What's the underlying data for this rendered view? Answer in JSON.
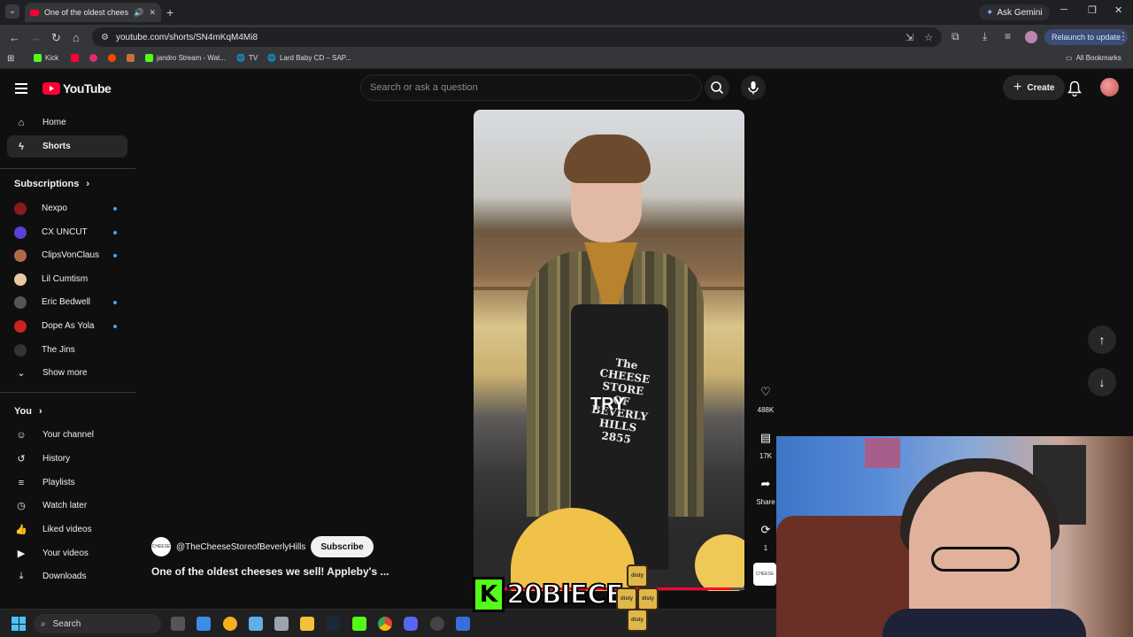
{
  "browser": {
    "tab_title": "One of the oldest cheeses w",
    "url": "youtube.com/shorts/SN4mKqM4Mi8",
    "ask_gemini": "Ask Gemini",
    "relaunch": "Relaunch to update",
    "all_bookmarks": "All Bookmarks",
    "bookmarks": [
      {
        "label": "Kick",
        "color": "#53fc18"
      },
      {
        "label": "",
        "color": "#ff0033"
      },
      {
        "label": "",
        "color": "#e22c6a"
      },
      {
        "label": "",
        "color": "#ff4500"
      },
      {
        "label": "",
        "color": "#c86f3b"
      },
      {
        "label": "jandro Stream - Wat...",
        "color": "#53fc18"
      },
      {
        "label": "TV",
        "color": "#999999"
      },
      {
        "label": "Lard Baby CD – SAP...",
        "color": "#999999"
      }
    ]
  },
  "header": {
    "logo": "YouTube",
    "search_placeholder": "Search or ask a question",
    "create": "Create"
  },
  "sidebar": {
    "main": [
      {
        "label": "Home",
        "icon": "home-icon"
      },
      {
        "label": "Shorts",
        "icon": "shorts-icon"
      }
    ],
    "subscriptions_title": "Subscriptions",
    "subscriptions": [
      {
        "label": "Nexpo",
        "color": "#8b1a1a",
        "live": true
      },
      {
        "label": "CX UNCUT",
        "color": "#5b3fd8",
        "live": true
      },
      {
        "label": "ClipsVonClaus",
        "color": "#b06a4a",
        "live": true
      },
      {
        "label": "Lil Cumtism",
        "color": "#e8c9a0",
        "live": false
      },
      {
        "label": "Eric Bedwell",
        "color": "#555555",
        "live": true
      },
      {
        "label": "Dope As Yola",
        "color": "#c22",
        "live": true
      },
      {
        "label": "The Jins",
        "color": "#333333",
        "live": false
      }
    ],
    "show_more": "Show more",
    "you_title": "You",
    "you_items": [
      {
        "label": "Your channel",
        "icon": "channel-icon"
      },
      {
        "label": "History",
        "icon": "history-icon"
      },
      {
        "label": "Playlists",
        "icon": "playlists-icon"
      },
      {
        "label": "Watch later",
        "icon": "watch-later-icon"
      },
      {
        "label": "Liked videos",
        "icon": "like-icon"
      },
      {
        "label": "Your videos",
        "icon": "your-videos-icon"
      },
      {
        "label": "Downloads",
        "icon": "download-icon"
      }
    ]
  },
  "video": {
    "apron_text": "The\nCHEESE STORE\nOF\nBEVERLY HILLS\n2855",
    "caption": "TRY",
    "channel": "@TheCheeseStoreofBeverlyHills",
    "subscribe": "Subscribe",
    "title": "One of the oldest cheeses we sell! Appleby's ...",
    "progress": 0.95
  },
  "actions": {
    "likes": "488K",
    "comments": "17K",
    "share": "Share",
    "remix": "1"
  },
  "overlay": {
    "streamer": "20BIECE",
    "jar_label": "disty"
  },
  "taskbar": {
    "search": "Search"
  }
}
